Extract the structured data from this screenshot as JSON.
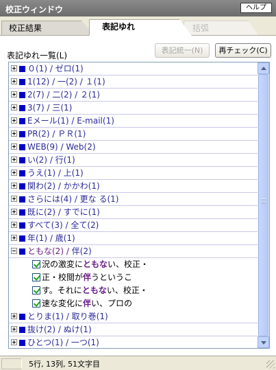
{
  "window": {
    "title": "校正ウィンドウ",
    "help_label": "ヘルプ"
  },
  "tabs": [
    {
      "label": "校正結果"
    },
    {
      "label": "表記ゆれ",
      "selected": true
    },
    {
      "label": "括弧",
      "disabled": true
    }
  ],
  "toolbar": {
    "list_label": "表記ゆれ一覧(L)",
    "unify_label": "表記統一(N)",
    "recheck_label": "再チェック(C)"
  },
  "tree": {
    "rows": [
      {
        "text": "０(1)",
        "alt": "ゼロ(1)",
        "expanded": false
      },
      {
        "text": "1(12)",
        "alt": "一(2)  /  １(1)",
        "expanded": false
      },
      {
        "text": "2(7)",
        "alt": "二(2)  /  ２(1)",
        "expanded": false
      },
      {
        "text": "3(7)",
        "alt": "三(1)",
        "expanded": false
      },
      {
        "text": "Eメール(1)",
        "alt": "E-mail(1)",
        "expanded": false
      },
      {
        "text": "PR(2)",
        "alt": "ＰＲ(1)",
        "expanded": false
      },
      {
        "text": "WEB(9)",
        "alt": "Web(2)",
        "expanded": false
      },
      {
        "text": "い(2)",
        "alt": "行(1)",
        "expanded": false
      },
      {
        "text": "うえ(1)",
        "alt": "上(1)",
        "expanded": false
      },
      {
        "text": "関わ(2)",
        "alt": "かかわ(1)",
        "expanded": false
      },
      {
        "text": "さらには(4)",
        "alt": "更な る(1)",
        "expanded": false
      },
      {
        "text": "既に(2)",
        "alt": "すでに(1)",
        "expanded": false
      },
      {
        "text": "すべて(3)",
        "alt": "全て(2)",
        "expanded": false
      },
      {
        "text": "年(1)",
        "alt": "歳(1)",
        "expanded": false
      },
      {
        "text": "ともな(2)",
        "alt": "伴(2)",
        "expanded": true,
        "children": [
          {
            "pre": "況の激変に",
            "hl": "ともな",
            "post": "い、校正・"
          },
          {
            "pre": "正・校閲が",
            "hl": "伴",
            "post": "うというこ"
          },
          {
            "pre": "す。それに",
            "hl": "ともな",
            "post": "い、校正・"
          },
          {
            "pre": "速な変化に",
            "hl": "伴",
            "post": "い、プロの"
          }
        ]
      },
      {
        "text": "とりま(1)",
        "alt": "取り巻(1)",
        "expanded": false
      },
      {
        "text": "抜け(2)",
        "alt": "ぬけ(1)",
        "expanded": false
      },
      {
        "text": "ひとつ(1)",
        "alt": "一つ(1)",
        "expanded": false
      }
    ]
  },
  "status": {
    "position": "5行, 13列, 51文字目"
  },
  "colors": {
    "title_bar": "#6c6c6c",
    "accent_square": "#0000c8",
    "highlight_text": "#6a1a8a",
    "check": "#21a121"
  }
}
